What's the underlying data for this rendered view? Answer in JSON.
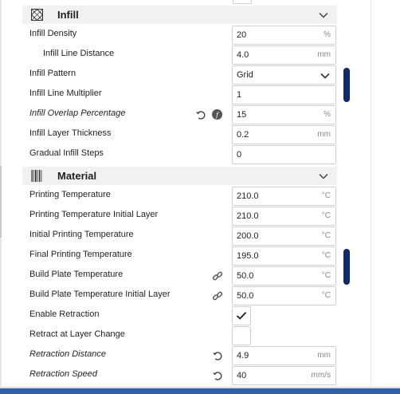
{
  "infill": {
    "header": "Infill",
    "rows": [
      {
        "label": "Infill Density",
        "value": "20",
        "unit": "%"
      },
      {
        "label": "Infill Line Distance",
        "value": "4.0",
        "unit": "mm"
      },
      {
        "label": "Infill Pattern",
        "value": "Grid"
      },
      {
        "label": "Infill Line Multiplier",
        "value": "1"
      },
      {
        "label": "Infill Overlap Percentage",
        "value": "15",
        "unit": "%"
      },
      {
        "label": "Infill Layer Thickness",
        "value": "0.2",
        "unit": "mm"
      },
      {
        "label": "Gradual Infill Steps",
        "value": "0"
      }
    ]
  },
  "material": {
    "header": "Material",
    "rows": [
      {
        "label": "Printing Temperature",
        "value": "210.0",
        "unit": "°C"
      },
      {
        "label": "Printing Temperature Initial Layer",
        "value": "210.0",
        "unit": "°C"
      },
      {
        "label": "Initial Printing Temperature",
        "value": "200.0",
        "unit": "°C"
      },
      {
        "label": "Final Printing Temperature",
        "value": "195.0",
        "unit": "°C"
      },
      {
        "label": "Build Plate Temperature",
        "value": "50.0",
        "unit": "°C"
      },
      {
        "label": "Build Plate Temperature Initial Layer",
        "value": "50.0",
        "unit": "°C"
      },
      {
        "label": "Enable Retraction",
        "checked": true
      },
      {
        "label": "Retract at Layer Change",
        "checked": false
      },
      {
        "label": "Retraction Distance",
        "value": "4.9",
        "unit": "mm"
      },
      {
        "label": "Retraction Speed",
        "value": "40",
        "unit": "mm/s"
      }
    ]
  },
  "colors": {
    "accent": "#0f2a6b",
    "header_bg": "#f1f1f1",
    "field_border": "#d0d0d0"
  },
  "icons": [
    "infill-category-icon",
    "material-category-icon",
    "chevron-down-icon",
    "reset-icon",
    "fx-icon",
    "link-icon",
    "checkmark-icon"
  ]
}
